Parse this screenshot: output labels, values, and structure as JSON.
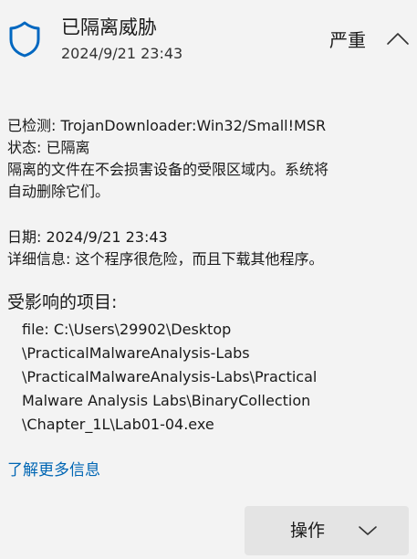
{
  "header": {
    "title": "已隔离威胁",
    "date": "2024/9/21 23:43",
    "severity": "严重",
    "shield_icon": "shield-icon",
    "collapse_icon": "chevron-up-icon",
    "accent_color": "#0067c0"
  },
  "details": {
    "detected": "已检测:  TrojanDownloader:Win32/Small!MSR",
    "status": "状态:  已隔离",
    "description_line1": "隔离的文件在不会损害设备的受限区域内。系统将",
    "description_line2": "自动删除它们。"
  },
  "info": {
    "date": "日期:  2024/9/21 23:43",
    "detail": "详细信息:  这个程序很危险，而且下载其他程序。"
  },
  "affected": {
    "title": "受影响的项目:",
    "path_lines": [
      "file: C:\\Users\\29902\\Desktop",
      "\\PracticalMalwareAnalysis-Labs",
      "\\PracticalMalwareAnalysis-Labs\\Practical",
      "Malware Analysis Labs\\BinaryCollection",
      "\\Chapter_1L\\Lab01-04.exe"
    ]
  },
  "learn_more": "了解更多信息",
  "action": {
    "label": "操作",
    "icon": "chevron-down-icon"
  }
}
